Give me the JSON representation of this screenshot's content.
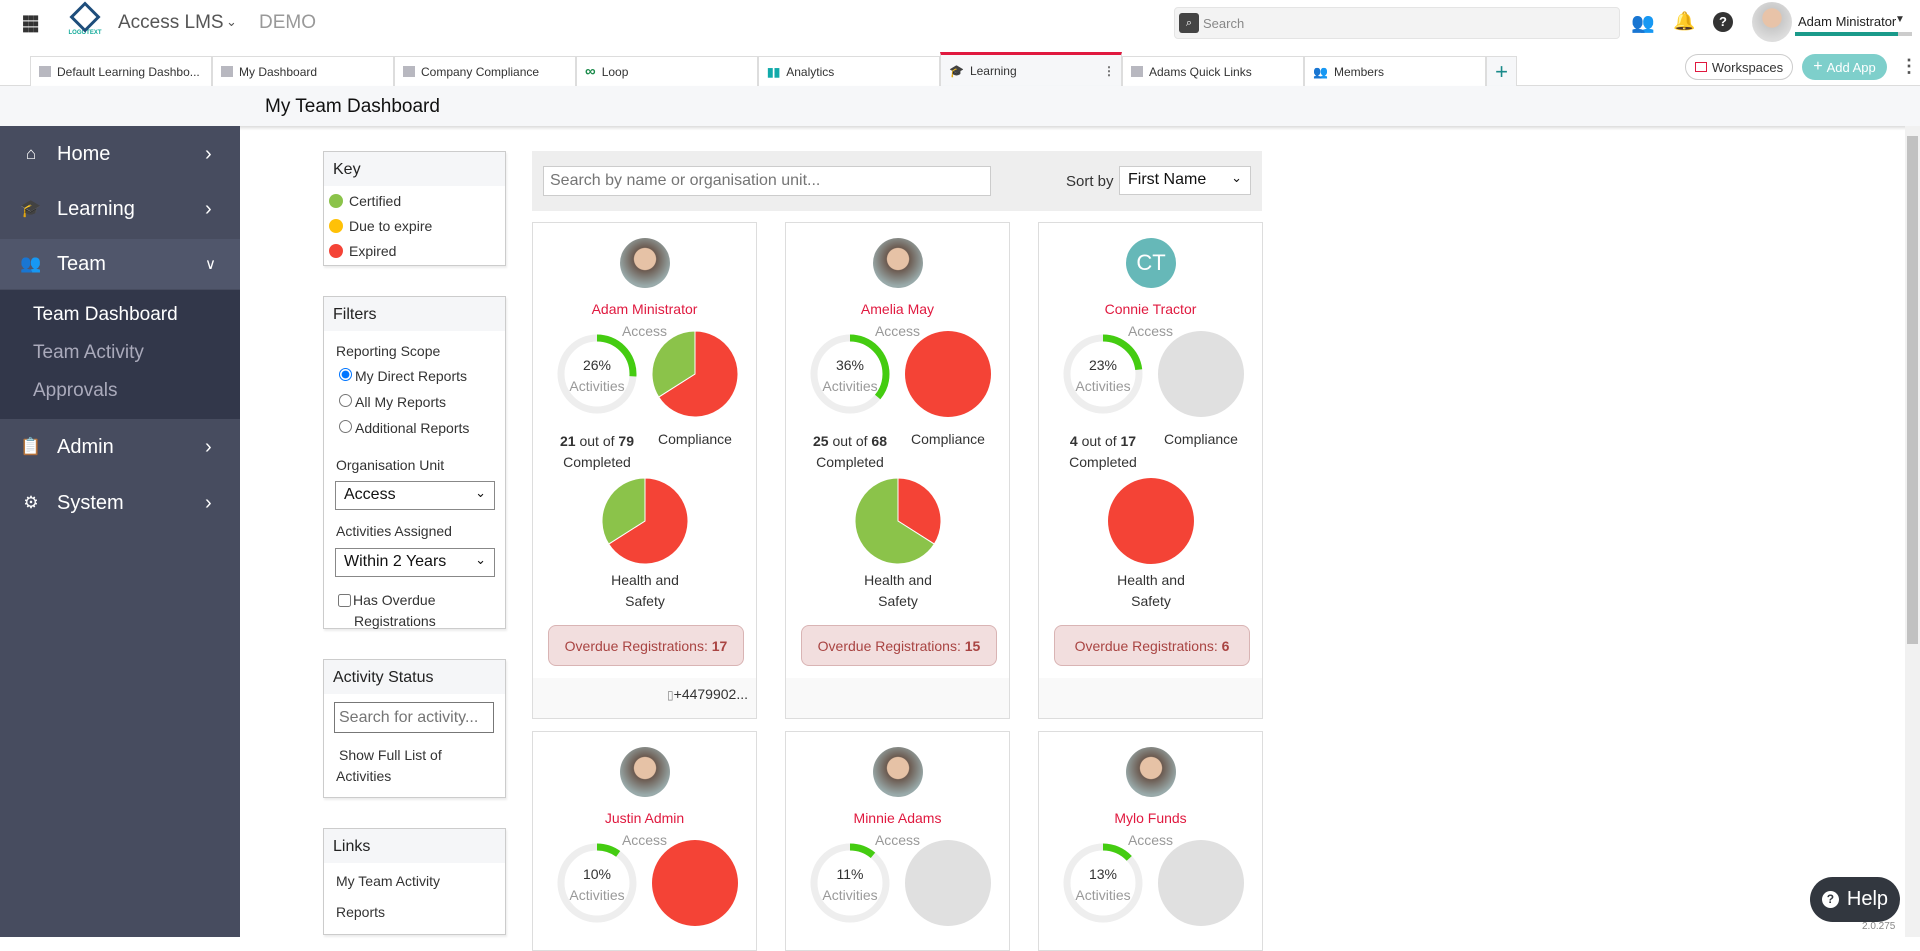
{
  "header": {
    "app_name": "Access LMS",
    "env": "DEMO",
    "logo_text": "LOGOTEXT",
    "search_placeholder": "Search",
    "user_name": "Adam Ministrator"
  },
  "tabs": [
    {
      "label": "Default Learning Dashbo...",
      "icon": "folder-icon"
    },
    {
      "label": "My Dashboard",
      "icon": "folder-icon"
    },
    {
      "label": "Company Compliance",
      "icon": "folder-icon"
    },
    {
      "label": "Loop",
      "icon": "infinity-icon"
    },
    {
      "label": "Analytics",
      "icon": "analytics-icon"
    },
    {
      "label": "Learning",
      "icon": "graduation-cap-icon",
      "active": true
    },
    {
      "label": "Adams Quick Links",
      "icon": "folder-icon"
    },
    {
      "label": "Members",
      "icon": "users-icon"
    }
  ],
  "tab_actions": {
    "add_tab": "+",
    "workspaces": "Workspaces",
    "add_app": "Add App"
  },
  "page_title": "My Team Dashboard",
  "sidebar": {
    "items": [
      {
        "label": "Home",
        "icon": "home-icon"
      },
      {
        "label": "Learning",
        "icon": "graduation-cap-icon"
      },
      {
        "label": "Team",
        "icon": "users-icon",
        "expanded": true
      },
      {
        "label": "Admin",
        "icon": "clipboard-icon"
      },
      {
        "label": "System",
        "icon": "gears-icon"
      }
    ],
    "team_sub": [
      "Team Dashboard",
      "Team Activity",
      "Approvals"
    ]
  },
  "key": {
    "title": "Key",
    "items": [
      {
        "label": "Certified",
        "color": "#8bc34a"
      },
      {
        "label": "Due to expire",
        "color": "#ffc107"
      },
      {
        "label": "Expired",
        "color": "#f44336"
      }
    ]
  },
  "filters": {
    "title": "Filters",
    "scope_label": "Reporting Scope",
    "scope_options": [
      "My Direct Reports",
      "All My Reports",
      "Additional Reports"
    ],
    "scope_selected": 0,
    "org_label": "Organisation Unit",
    "org_value": "Access",
    "assigned_label": "Activities Assigned",
    "assigned_value": "Within 2 Years",
    "overdue_label_1": "Has Overdue",
    "overdue_label_2": "Registrations",
    "overdue_checked": false
  },
  "activity_status": {
    "title": "Activity Status",
    "placeholder": "Search for activity...",
    "link_1": "Show Full List of",
    "link_2": "Activities"
  },
  "links": {
    "title": "Links",
    "items": [
      "My Team Activity",
      "Reports"
    ]
  },
  "toolbar": {
    "search_placeholder": "Search by name or organisation unit...",
    "sort_label": "Sort by",
    "sort_value": "First Name"
  },
  "labels": {
    "activities": "Activities",
    "out_of": "out of",
    "completed": "Completed",
    "compliance": "Compliance",
    "hs1": "Health and",
    "hs2": "Safety",
    "overdue": "Overdue Registrations:"
  },
  "colors": {
    "certified": "#8bc34a",
    "expired": "#f44336",
    "none": "#e0e0e0",
    "progress": "#44cc11",
    "accent": "#e0193f"
  },
  "members": [
    {
      "name": "Adam Ministrator",
      "unit": "Access",
      "pct": "26%",
      "pct_value": 26,
      "done": "21",
      "total": "79",
      "compliance": {
        "expired": 66,
        "certified": 34
      },
      "hs": {
        "expired": 66,
        "certified": 34
      },
      "overdue": "17",
      "phone": "+4479902...",
      "avatar": "photo"
    },
    {
      "name": "Amelia May",
      "unit": "Access",
      "pct": "36%",
      "pct_value": 36,
      "done": "25",
      "total": "68",
      "compliance": {
        "expired": 100,
        "certified": 0
      },
      "hs": {
        "expired": 34,
        "certified": 66
      },
      "overdue": "15",
      "avatar": "photo"
    },
    {
      "name": "Connie Tractor",
      "unit": "Access",
      "pct": "23%",
      "pct_value": 23,
      "done": "4",
      "total": "17",
      "compliance": null,
      "hs": {
        "expired": 100,
        "certified": 0
      },
      "overdue": "6",
      "initials": "CT",
      "avatar": "initials"
    },
    {
      "name": "Justin Admin",
      "unit": "Access",
      "pct": "10%",
      "pct_value": 10,
      "compliance": {
        "expired": 100,
        "certified": 0
      },
      "avatar": "photo"
    },
    {
      "name": "Minnie Adams",
      "unit": "Access",
      "pct": "11%",
      "pct_value": 11,
      "compliance": null,
      "avatar": "photo"
    },
    {
      "name": "Mylo Funds",
      "unit": "Access",
      "pct": "13%",
      "pct_value": 13,
      "compliance": null,
      "avatar": "photo"
    }
  ],
  "help": {
    "label": "Help",
    "version": "2.0.275"
  }
}
